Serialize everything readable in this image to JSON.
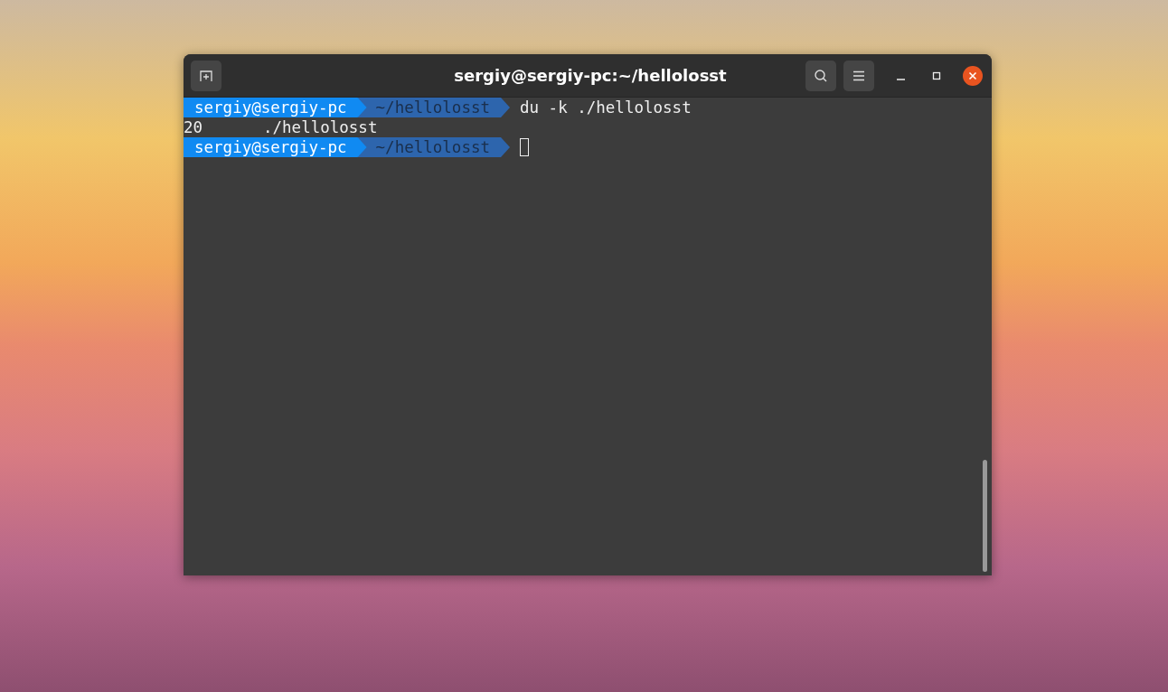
{
  "window": {
    "title": "sergiy@sergiy-pc:~/hellolosst"
  },
  "terminal": {
    "lines": [
      {
        "kind": "prompt",
        "user": "sergiy@sergiy-pc",
        "path": "~/hellolosst",
        "command": "du -k ./hellolosst",
        "cursor": false
      },
      {
        "kind": "output",
        "size": "20",
        "path": "./hellolosst"
      },
      {
        "kind": "prompt",
        "user": "sergiy@sergiy-pc",
        "path": "~/hellolosst",
        "cursor": true
      }
    ]
  }
}
